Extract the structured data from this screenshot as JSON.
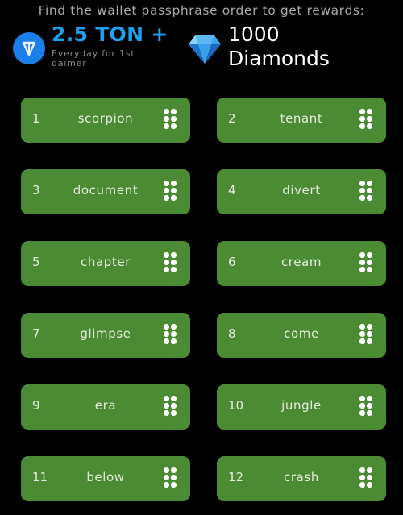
{
  "header": {
    "title": "Find the wallet passphrase order to get rewards:",
    "ton_reward": {
      "icon": "ton-logo-icon",
      "amount": "2.5 TON +",
      "subtitle": "Everyday for 1st daimer",
      "color": "#1ea0ee"
    },
    "diamond_reward": {
      "icon": "diamond-icon",
      "count": "1000",
      "label": "Diamonds"
    }
  },
  "passphrase": {
    "card_color": "#4b8b33",
    "handle_icon": "drag-handle-icon",
    "words": [
      {
        "index": "1",
        "word": "scorpion"
      },
      {
        "index": "2",
        "word": "tenant"
      },
      {
        "index": "3",
        "word": "document"
      },
      {
        "index": "4",
        "word": "divert"
      },
      {
        "index": "5",
        "word": "chapter"
      },
      {
        "index": "6",
        "word": "cream"
      },
      {
        "index": "7",
        "word": "glimpse"
      },
      {
        "index": "8",
        "word": "come"
      },
      {
        "index": "9",
        "word": "era"
      },
      {
        "index": "10",
        "word": "jungle"
      },
      {
        "index": "11",
        "word": "below"
      },
      {
        "index": "12",
        "word": "crash"
      }
    ]
  }
}
